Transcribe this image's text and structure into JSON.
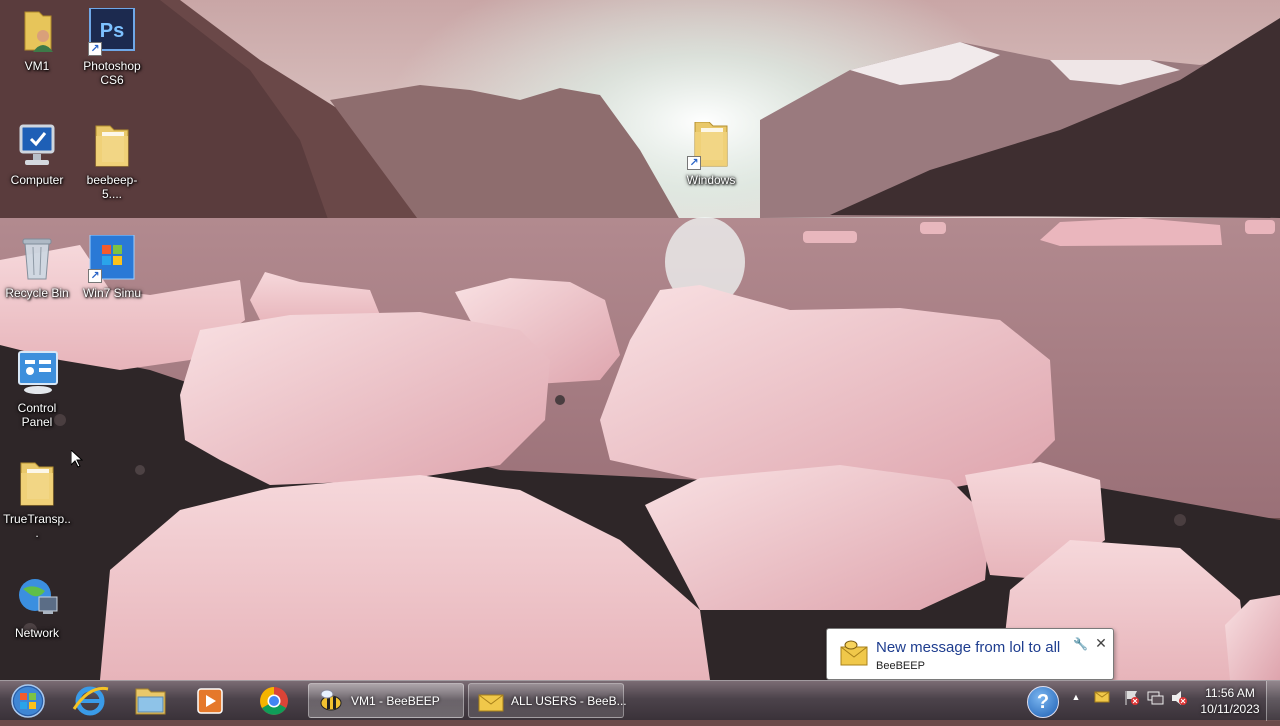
{
  "desktop": {
    "icons": [
      {
        "label": "VM1",
        "icon": "user-folder-icon"
      },
      {
        "label": "Photoshop CS6",
        "icon": "photoshop-icon"
      },
      {
        "label": "Computer",
        "icon": "computer-icon"
      },
      {
        "label": "beebeep-5....",
        "icon": "folder-icon"
      },
      {
        "label": "Windows",
        "icon": "folder-shortcut-icon"
      },
      {
        "label": "Recycle Bin",
        "icon": "recycle-bin-icon"
      },
      {
        "label": "Win7 Simu",
        "icon": "win7-simu-icon"
      },
      {
        "label": "Control Panel",
        "icon": "control-panel-icon"
      },
      {
        "label": "TrueTransp...",
        "icon": "folder-icon"
      },
      {
        "label": "Network",
        "icon": "network-icon"
      }
    ]
  },
  "notification": {
    "title": "New message from lol to all",
    "app": "BeeBEEP",
    "pin_glyph": "🔧",
    "close_glyph": "✕"
  },
  "taskbar": {
    "pinned": [
      "start-orb-icon",
      "internet-explorer-icon",
      "file-explorer-icon",
      "media-player-icon",
      "chrome-icon"
    ],
    "windows": [
      {
        "label": "VM1 - BeeBEEP",
        "icon": "beebeep-bee-icon"
      },
      {
        "label": "ALL USERS - BeeB...",
        "icon": "beebeep-chat-icon"
      }
    ],
    "tray": {
      "help_glyph": "?",
      "expand_glyph": "▲"
    },
    "clock": {
      "time": "11:56 AM",
      "date": "10/11/2023"
    }
  },
  "colors": {
    "balloon_title": "#1e3d8f",
    "taskbar_top": "#7b6c74",
    "taskbar_bottom": "#3a3239"
  }
}
